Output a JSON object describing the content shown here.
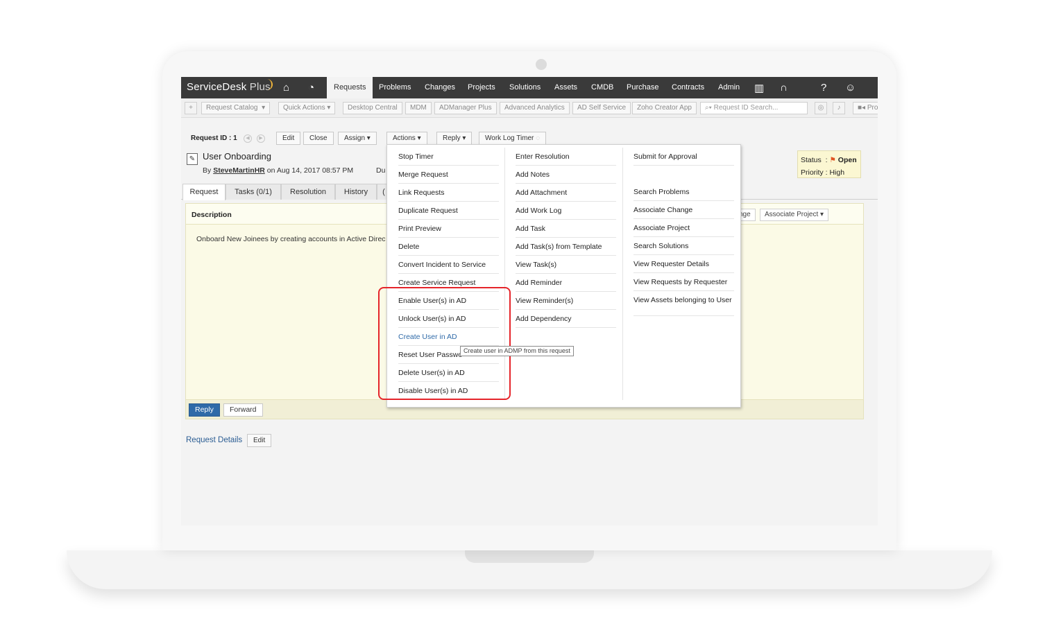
{
  "nav": {
    "brand": "ServiceDesk",
    "brand_plus": "Plus",
    "home_icon": "home-icon",
    "dashboard_icon": "dashboard-icon",
    "items": [
      "Requests",
      "Problems",
      "Changes",
      "Projects",
      "Solutions",
      "Assets",
      "CMDB",
      "Purchase",
      "Contracts",
      "Admin"
    ],
    "active": "Requests",
    "right_icons": [
      "reports-icon",
      "headset-icon",
      "help-icon",
      "user-icon"
    ]
  },
  "toolbar": {
    "request_catalog": "Request Catalog",
    "quick_actions": "Quick Actions",
    "desktop_central": "Desktop Central",
    "mdm": "MDM",
    "admanager": "ADManager Plus",
    "advanced_analytics": "Advanced Analytics",
    "ad_self_service": "AD Self Service",
    "zoho_creator": "Zoho Creator App",
    "search_placeholder": "Request ID Search...",
    "pro": "Pro"
  },
  "request": {
    "id_label": "Request ID : 1",
    "buttons": [
      "Edit",
      "Close",
      "Assign",
      "Actions",
      "Reply",
      "Work Log Timer"
    ],
    "subject": "User Onboarding",
    "by": "By",
    "user": "SteveMartinHR",
    "on": "on  Aug 14, 2017 08:57 PM",
    "due_prefix": "Du",
    "status_label": "Status",
    "status_value": "Open",
    "priority_label": "Priority",
    "priority_value": "High",
    "accent_color": "#2f6aa8"
  },
  "tabs": [
    "Request",
    "Tasks (0/1)",
    "Resolution",
    "History",
    "("
  ],
  "description": {
    "title": "Description",
    "text": "Onboard New Joinees by creating accounts in Active Direc",
    "btn_change": "nge",
    "btn_project": "Associate Project",
    "reply": "Reply",
    "forward": "Forward"
  },
  "details": {
    "label": "Request Details",
    "edit": "Edit"
  },
  "actions_menu": {
    "col1": [
      "Stop Timer",
      "Merge Request",
      "Link Requests",
      "Duplicate Request",
      "Print Preview",
      "Delete",
      "Convert Incident to Service",
      "Create Service Request",
      "Enable User(s) in AD",
      "Unlock User(s) in AD",
      "Create User in AD",
      "Reset User Passwo",
      "Delete User(s) in AD",
      "Disable User(s) in AD"
    ],
    "col2": [
      "Enter Resolution",
      "Add Notes",
      "Add Attachment",
      "Add Work Log",
      "Add Task",
      "Add Task(s) from Template",
      "View Task(s)",
      "Add Reminder",
      "View Reminder(s)",
      "Add Dependency"
    ],
    "col3": [
      "Submit for Approval",
      "Search Problems",
      "Associate Change",
      "Associate Project",
      "Search Solutions",
      "View Requester Details",
      "View Requests by Requester",
      "View Assets belonging to User"
    ],
    "tooltip": "Create user in ADMP from this request",
    "highlight_color": "#e5242a"
  }
}
